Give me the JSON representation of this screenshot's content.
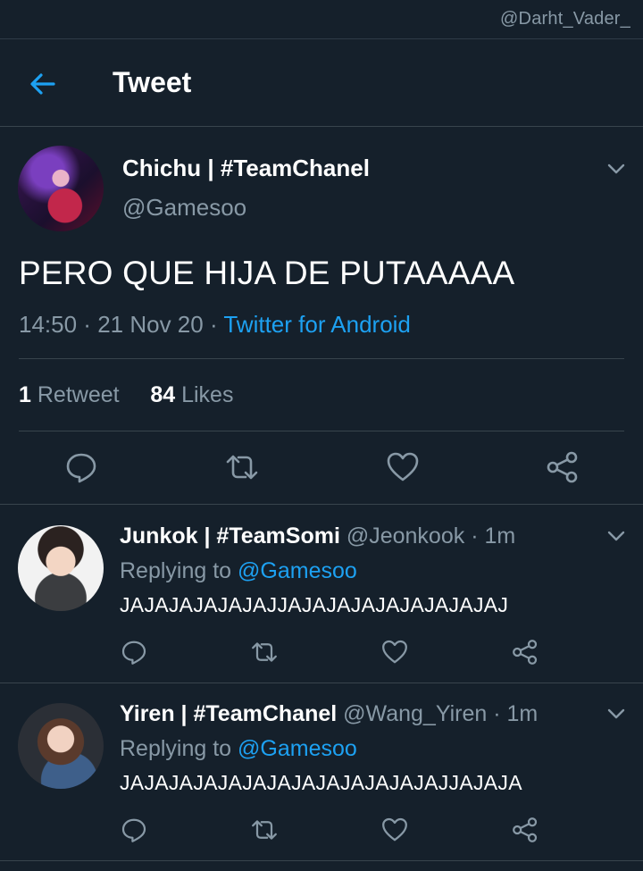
{
  "watermark": "@Darht_Vader_",
  "header": {
    "title": "Tweet"
  },
  "tweet": {
    "author_name": "Chichu | #TeamChanel",
    "author_handle": "@Gamesoo",
    "text": "PERO QUE HIJA DE PUTAAAAA",
    "time": "14:50",
    "date": "21 Nov 20",
    "source": "Twitter for Android",
    "retweet_count": "1",
    "retweet_label": "Retweet",
    "like_count": "84",
    "like_label": "Likes"
  },
  "replies": [
    {
      "name": "Junkok | #TeamSomi",
      "handle": "@Jeonkook",
      "time": "1m",
      "replying_prefix": "Replying to",
      "replying_to": "@Gamesoo",
      "text": "JAJAJAJAJAJAJJAJAJAJAJAJAJAJAJAJ"
    },
    {
      "name": "Yiren | #TeamChanel",
      "handle": "@Wang_Yiren",
      "time": "1m",
      "replying_prefix": "Replying to",
      "replying_to": "@Gamesoo",
      "text": "JAJAJAJAJAJAJAJAJAJAJAJAJAJJAJAJA"
    }
  ],
  "icons": {
    "back": "arrow-left-icon",
    "menu": "chevron-down-icon",
    "reply": "comment-icon",
    "retweet": "retweet-icon",
    "like": "heart-icon",
    "share": "share-icon"
  },
  "colors": {
    "background": "#15202b",
    "accent": "#1da1f2",
    "muted": "#8899a6",
    "divider": "#38444d"
  }
}
